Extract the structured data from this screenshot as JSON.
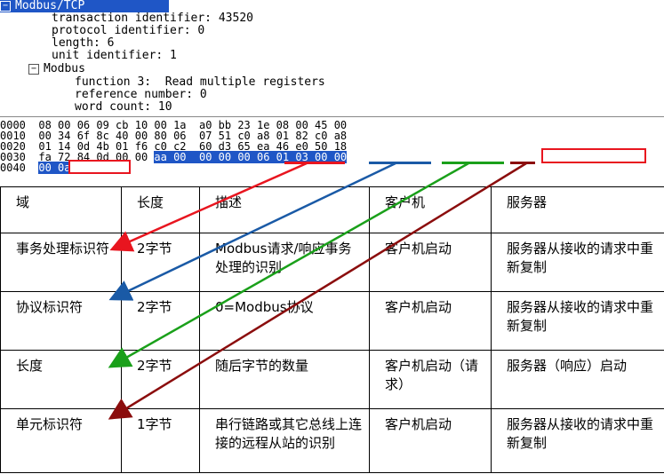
{
  "tree": {
    "header": "Modbus/TCP",
    "lines": [
      "transaction identifier: 43520",
      "protocol identifier: 0",
      "length: 6",
      "unit identifier: 1"
    ],
    "modbus_label": "Modbus",
    "modbus_lines": [
      "function 3:  Read multiple registers",
      "reference number: 0",
      "word count: 10"
    ]
  },
  "hex": {
    "rows": [
      {
        "offset": "0000",
        "bytes": "08 00 06 09 cb 10 00 1a  a0 bb 23 1e 08 00 45 00"
      },
      {
        "offset": "0010",
        "bytes": "00 34 6f 8c 40 00 80 06  07 51 c0 a8 01 82 c0 a8"
      },
      {
        "offset": "0020",
        "bytes": "01 14 0d 4b 01 f6 c0 c2  60 d3 65 ea 46 e0 50 18"
      },
      {
        "offset": "0030",
        "bytes_plain": "fa 72 84 0d 00 00 ",
        "bytes_sel": "aa 00  00 00 00 06 01 03 00 00"
      },
      {
        "offset": "0040",
        "bytes_sel": "00 0a"
      }
    ]
  },
  "table": {
    "headers": [
      "域",
      "长度",
      "描述",
      "客户机",
      "服务器"
    ],
    "rows": [
      [
        "事务处理标识符",
        "2字节",
        "Modbus请求/响应事务处理的识别",
        "客户机启动",
        "服务器从接收的请求中重新复制"
      ],
      [
        "协议标识符",
        "2字节",
        "0=Modbus协议",
        "客户机启动",
        "服务器从接收的请求中重新复制"
      ],
      [
        "长度",
        "2字节",
        "随后字节的数量",
        "客户机启动（请求）",
        "服务器（响应）启动"
      ],
      [
        "单元标识符",
        "1字节",
        "串行链路或其它总线上连接的远程从站的识别",
        "客户机启动",
        "服务器从接收的请求中重新复制"
      ]
    ]
  },
  "colors": {
    "selection": "#1f56c6",
    "arrow_transaction": "#e8151f",
    "arrow_protocol": "#1a5aa6",
    "arrow_length": "#1aa01a",
    "arrow_unit": "#8b0d0d"
  }
}
